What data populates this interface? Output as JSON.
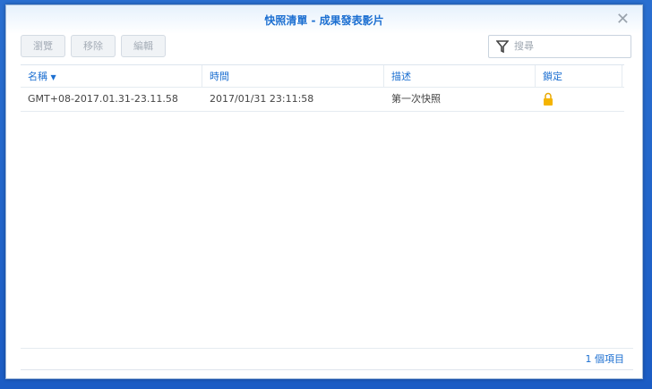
{
  "window": {
    "title": "快照清單 - 成果發表影片"
  },
  "toolbar": {
    "browse": "瀏覽",
    "remove": "移除",
    "edit": "編輯",
    "search_placeholder": "搜尋"
  },
  "table": {
    "headers": [
      "名稱",
      "時間",
      "描述",
      "鎖定"
    ],
    "rows": [
      {
        "name": "GMT+08-2017.01.31-23.11.58",
        "time": "2017/01/31 23:11:58",
        "description": "第一次快照",
        "locked": true
      }
    ]
  },
  "footer": {
    "count": "1 個項目"
  },
  "colors": {
    "accent": "#1c6fd1",
    "lock": "#f5b400"
  }
}
